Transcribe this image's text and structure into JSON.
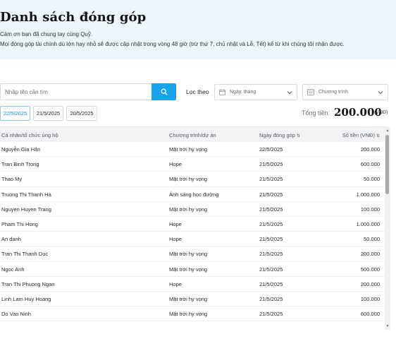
{
  "header": {
    "title": "Danh sách đóng góp",
    "subtitle_1": "Cảm ơn bạn đã chung tay cùng Quỹ.",
    "subtitle_2": "Mọi đóng góp tài chính dù lớn hay nhỏ sẽ được cập nhật trong vòng 48 giờ (trừ thứ 7, chủ nhật và Lễ, Tết) kể từ khi chúng tôi nhận được."
  },
  "search": {
    "placeholder": "Nhập tên cần tìm"
  },
  "filter": {
    "label": "Lọc theo",
    "date_select": "Ngày, tháng",
    "program_select": "Chương trình"
  },
  "date_chips": [
    "22/5/2025",
    "21/5/2025",
    "20/5/2025"
  ],
  "total": {
    "label": "Tổng tiền:",
    "value": "200.000",
    "unit": "(VNĐ)"
  },
  "table": {
    "columns": [
      "Cá nhân/tổ chức ủng hộ",
      "Chương trình/dự án",
      "Ngày đóng góp",
      "Số tiền (VNĐ)"
    ],
    "rows": [
      [
        "Nguyễn Gia Hân",
        "Mặt trời hy vọng",
        "22/5/2025",
        "200.000"
      ],
      [
        "Tran Binh Trong",
        "Hope",
        "21/5/2025",
        "600.000"
      ],
      [
        "Thao My",
        "Mặt trời hy vọng",
        "21/5/2025",
        "50.000"
      ],
      [
        "Truong Thi Thanh Ha",
        "Ánh sáng học đường",
        "21/5/2025",
        "1.000.000"
      ],
      [
        "Nguyen Huyen Trang",
        "Mặt trời hy vọng",
        "21/5/2025",
        "100.000"
      ],
      [
        "Pham Thi Hong",
        "Hope",
        "21/5/2025",
        "1.000.000"
      ],
      [
        "An danh",
        "Hope",
        "21/5/2025",
        "50.000"
      ],
      [
        "Tran Thi Thanh Duc",
        "Mặt trời hy vọng",
        "21/5/2025",
        "200.000"
      ],
      [
        "Ngoc Anh",
        "Mặt trời hy vọng",
        "21/5/2025",
        "500.000"
      ],
      [
        "Tran Thi Phuong Ngan",
        "Hope",
        "21/5/2025",
        "200.000"
      ],
      [
        "Linh Lam Huy Hoang",
        "Mặt trời hy vọng",
        "21/5/2025",
        "100.000"
      ],
      [
        "Do Van Ninh",
        "Mặt trời hy vọng",
        "21/5/2025",
        "600.000"
      ]
    ]
  },
  "colors": {
    "accent": "#1aa3e8",
    "hero_bg": "#edf6fb"
  },
  "icons": {
    "search": "search-icon",
    "calendar": "calendar-icon",
    "list": "list-icon",
    "chevron": "chevron-down-icon",
    "sort": "sort-icon"
  }
}
